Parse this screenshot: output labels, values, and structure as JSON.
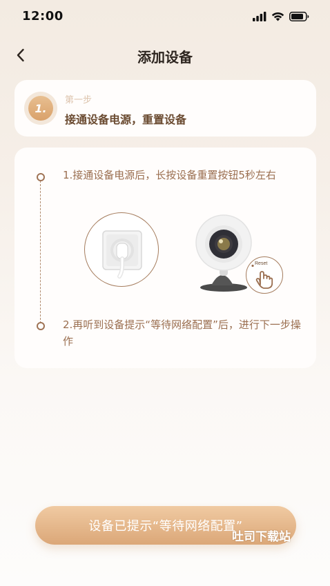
{
  "status_bar": {
    "time": "12:00",
    "icons": [
      "cellular-signal-icon",
      "wifi-icon",
      "battery-icon"
    ]
  },
  "nav": {
    "back_icon": "chevron-left-icon",
    "title": "添加设备"
  },
  "step_card": {
    "badge": "1.",
    "label": "第一步",
    "title": "接通设备电源，重置设备"
  },
  "instructions": {
    "step1": "1.接通设备电源后，长按设备重置按钮5秒左右",
    "step2": "2.再听到设备提示“等待网络配置”后，进行下一步操作",
    "reset_label": "Reset",
    "illustrations": [
      "power-socket-icon",
      "camera-icon",
      "hand-pointer-icon"
    ]
  },
  "primary_button": {
    "label": "设备已提示“等待网络配置”"
  },
  "watermark": "吐司下载站",
  "colors": {
    "accent": "#d9a16a",
    "text_brown": "#9a6e4f",
    "title_brown": "#6a4a30"
  }
}
